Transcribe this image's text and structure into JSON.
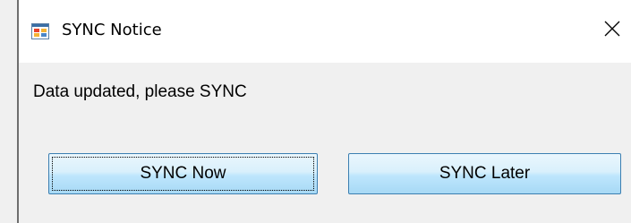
{
  "window": {
    "title": "SYNC Notice",
    "icon": "windows-app-icon",
    "close_icon": "close-icon"
  },
  "message": "Data updated, please SYNC",
  "buttons": {
    "sync_now": "SYNC Now",
    "sync_later": "SYNC Later"
  },
  "colors": {
    "button_border": "#3c7fb1",
    "button_fill": "#bee6fd",
    "dialog_background": "#f0f0f0",
    "titlebar_background": "#ffffff"
  }
}
